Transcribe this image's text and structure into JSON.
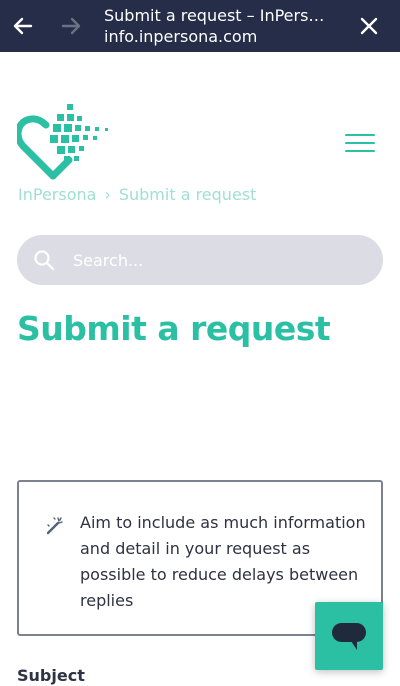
{
  "browser": {
    "title": "Submit a request – InPersona",
    "url": "info.inpersona.com",
    "back_icon": "arrow-left-icon",
    "forward_icon": "arrow-right-icon",
    "close_icon": "close-icon"
  },
  "header": {
    "logo_icon": "heart-pixel-logo-icon",
    "menu_icon": "hamburger-menu-icon"
  },
  "breadcrumb": {
    "items": [
      "InPersona",
      "Submit a request"
    ],
    "separator": "›"
  },
  "search": {
    "placeholder": "Search...",
    "value": ""
  },
  "page": {
    "title": "Submit a request"
  },
  "info_box": {
    "icon": "magic-wand-icon",
    "text": "Aim to include as much information and detail in your request as possible to reduce delays between replies"
  },
  "form": {
    "subject_label": "Subject"
  },
  "chat": {
    "icon": "chat-bubble-icon"
  },
  "colors": {
    "topbar": "#252d48",
    "accent": "#2bbfa4",
    "breadcrumb": "#9fe0d3",
    "search_bg": "#dcdde4"
  }
}
